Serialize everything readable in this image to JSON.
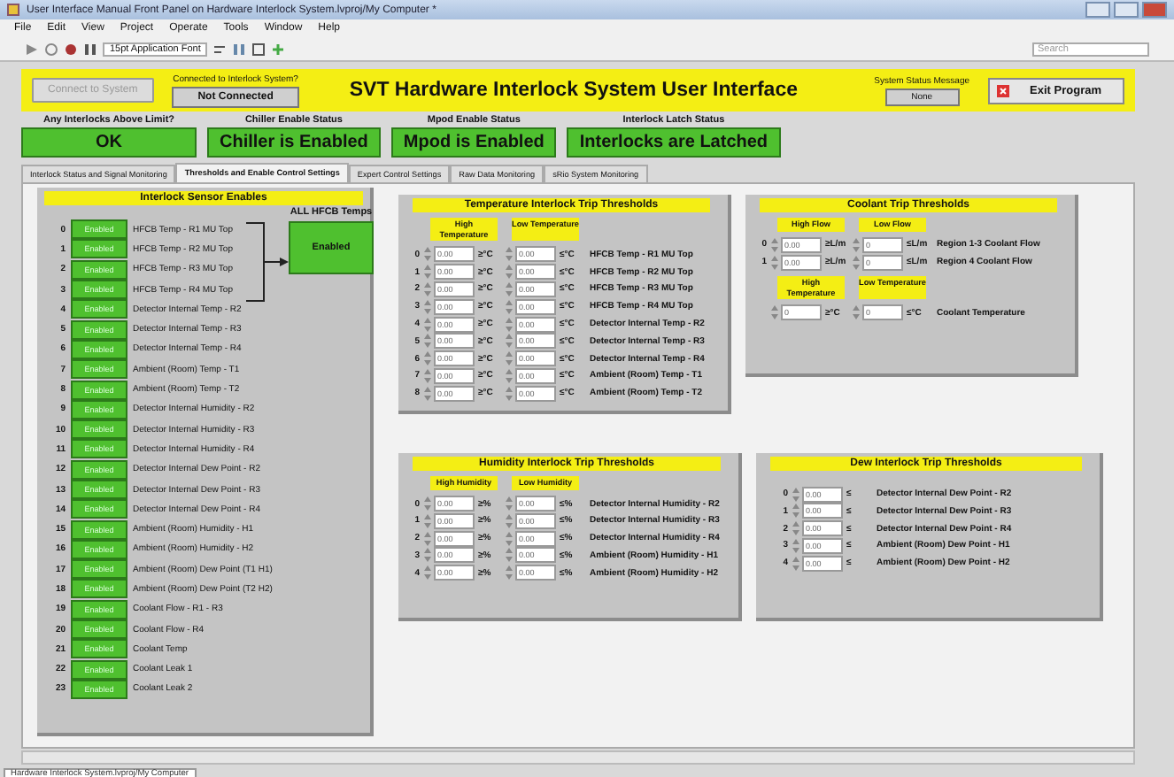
{
  "window": {
    "title": "User Interface Manual Front Panel on Hardware Interlock System.lvproj/My Computer *"
  },
  "menu": [
    "File",
    "Edit",
    "View",
    "Project",
    "Operate",
    "Tools",
    "Window",
    "Help"
  ],
  "toolbar": {
    "font": "15pt Application Font",
    "search_placeholder": "Search"
  },
  "header": {
    "connect_button": "Connect to System",
    "connected_label": "Connected to Interlock System?",
    "connected_value": "Not Connected",
    "title": "SVT Hardware Interlock System User Interface",
    "status_label": "System Status Message",
    "status_value": "None",
    "exit_button": "Exit Program"
  },
  "indicators": [
    {
      "label": "Any Interlocks Above Limit?",
      "value": "OK"
    },
    {
      "label": "Chiller Enable Status",
      "value": "Chiller is Enabled"
    },
    {
      "label": "Mpod Enable Status",
      "value": "Mpod is Enabled"
    },
    {
      "label": "Interlock Latch Status",
      "value": "Interlocks are Latched"
    }
  ],
  "tabs": [
    {
      "label": "Interlock Status and Signal Monitoring",
      "selected": false
    },
    {
      "label": "Thresholds and Enable Control Settings",
      "selected": true
    },
    {
      "label": "Expert Control Settings",
      "selected": false
    },
    {
      "label": "Raw Data Monitoring",
      "selected": false
    },
    {
      "label": "sRio System Monitoring",
      "selected": false
    }
  ],
  "sensor_enables": {
    "title": "Interlock Sensor Enables",
    "all_hfcb": {
      "label": "ALL HFCB Temps",
      "button": "Enabled"
    },
    "rows": [
      {
        "index": "0",
        "button": "Enabled",
        "label": "HFCB Temp - R1 MU Top"
      },
      {
        "index": "1",
        "button": "Enabled",
        "label": "HFCB Temp - R2 MU Top"
      },
      {
        "index": "2",
        "button": "Enabled",
        "label": "HFCB Temp - R3 MU Top"
      },
      {
        "index": "3",
        "button": "Enabled",
        "label": "HFCB Temp - R4 MU Top"
      },
      {
        "index": "4",
        "button": "Enabled",
        "label": "Detector Internal Temp - R2"
      },
      {
        "index": "5",
        "button": "Enabled",
        "label": "Detector Internal Temp - R3"
      },
      {
        "index": "6",
        "button": "Enabled",
        "label": "Detector Internal Temp - R4"
      },
      {
        "index": "7",
        "button": "Enabled",
        "label": "Ambient (Room) Temp - T1"
      },
      {
        "index": "8",
        "button": "Enabled",
        "label": "Ambient (Room) Temp - T2"
      },
      {
        "index": "9",
        "button": "Enabled",
        "label": "Detector Internal Humidity - R2"
      },
      {
        "index": "10",
        "button": "Enabled",
        "label": "Detector Internal Humidity - R3"
      },
      {
        "index": "11",
        "button": "Enabled",
        "label": "Detector Internal Humidity - R4"
      },
      {
        "index": "12",
        "button": "Enabled",
        "label": "Detector Internal Dew Point - R2"
      },
      {
        "index": "13",
        "button": "Enabled",
        "label": "Detector Internal Dew Point - R3"
      },
      {
        "index": "14",
        "button": "Enabled",
        "label": "Detector Internal Dew Point - R4"
      },
      {
        "index": "15",
        "button": "Enabled",
        "label": "Ambient (Room) Humidity - H1"
      },
      {
        "index": "16",
        "button": "Enabled",
        "label": "Ambient (Room) Humidity - H2"
      },
      {
        "index": "17",
        "button": "Enabled",
        "label": "Ambient (Room) Dew Point (T1 H1)"
      },
      {
        "index": "18",
        "button": "Enabled",
        "label": "Ambient (Room) Dew Point (T2 H2)"
      },
      {
        "index": "19",
        "button": "Enabled",
        "label": "Coolant Flow - R1 - R3"
      },
      {
        "index": "20",
        "button": "Enabled",
        "label": "Coolant Flow - R4"
      },
      {
        "index": "21",
        "button": "Enabled",
        "label": "Coolant Temp"
      },
      {
        "index": "22",
        "button": "Enabled",
        "label": "Coolant Leak 1"
      },
      {
        "index": "23",
        "button": "Enabled",
        "label": "Coolant Leak 2"
      }
    ]
  },
  "temperature_thresholds": {
    "title": "Temperature Interlock Trip Thresholds",
    "columns": [
      "High Temperature",
      "Low Temperature"
    ],
    "rows": [
      {
        "index": "0",
        "high": "0.00",
        "high_unit": "≥°C",
        "low": "0.00",
        "low_unit": "≤°C",
        "label": "HFCB Temp - R1 MU Top"
      },
      {
        "index": "1",
        "high": "0.00",
        "high_unit": "≥°C",
        "low": "0.00",
        "low_unit": "≤°C",
        "label": "HFCB Temp - R2 MU Top"
      },
      {
        "index": "2",
        "high": "0.00",
        "high_unit": "≥°C",
        "low": "0.00",
        "low_unit": "≤°C",
        "label": "HFCB Temp - R3 MU Top"
      },
      {
        "index": "3",
        "high": "0.00",
        "high_unit": "≥°C",
        "low": "0.00",
        "low_unit": "≤°C",
        "label": "HFCB Temp - R4 MU Top"
      },
      {
        "index": "4",
        "high": "0.00",
        "high_unit": "≥°C",
        "low": "0.00",
        "low_unit": "≤°C",
        "label": "Detector Internal Temp - R2"
      },
      {
        "index": "5",
        "high": "0.00",
        "high_unit": "≥°C",
        "low": "0.00",
        "low_unit": "≤°C",
        "label": "Detector Internal Temp - R3"
      },
      {
        "index": "6",
        "high": "0.00",
        "high_unit": "≥°C",
        "low": "0.00",
        "low_unit": "≤°C",
        "label": "Detector Internal Temp - R4"
      },
      {
        "index": "7",
        "high": "0.00",
        "high_unit": "≥°C",
        "low": "0.00",
        "low_unit": "≤°C",
        "label": "Ambient (Room) Temp - T1"
      },
      {
        "index": "8",
        "high": "0.00",
        "high_unit": "≥°C",
        "low": "0.00",
        "low_unit": "≤°C",
        "label": "Ambient (Room) Temp - T2"
      }
    ]
  },
  "coolant_thresholds": {
    "title": "Coolant Trip Thresholds",
    "columns": [
      "High Flow",
      "Low Flow"
    ],
    "rows": [
      {
        "index": "0",
        "high": "0.00",
        "high_unit": "≥L/m",
        "low": "0",
        "low_unit": "≤L/m",
        "label": "Region 1-3 Coolant Flow"
      },
      {
        "index": "1",
        "high": "0.00",
        "high_unit": "≥L/m",
        "low": "0",
        "low_unit": "≤L/m",
        "label": "Region 4 Coolant Flow"
      }
    ],
    "temp_columns": [
      "High Temperature",
      "Low Temperature"
    ],
    "temp_row": {
      "high": "0",
      "high_unit": "≥°C",
      "low": "0",
      "low_unit": "≤°C",
      "label": "Coolant Temperature"
    }
  },
  "humidity_thresholds": {
    "title": "Humidity Interlock Trip Thresholds",
    "columns": [
      "High Humidity",
      "Low Humidity"
    ],
    "rows": [
      {
        "index": "0",
        "high": "0.00",
        "high_unit": "≥%",
        "low": "0.00",
        "low_unit": "≤%",
        "label": "Detector Internal Humidity - R2"
      },
      {
        "index": "1",
        "high": "0.00",
        "high_unit": "≥%",
        "low": "0.00",
        "low_unit": "≤%",
        "label": "Detector Internal Humidity - R3"
      },
      {
        "index": "2",
        "high": "0.00",
        "high_unit": "≥%",
        "low": "0.00",
        "low_unit": "≤%",
        "label": "Detector Internal Humidity - R4"
      },
      {
        "index": "3",
        "high": "0.00",
        "high_unit": "≥%",
        "low": "0.00",
        "low_unit": "≤%",
        "label": "Ambient (Room) Humidity - H1"
      },
      {
        "index": "4",
        "high": "0.00",
        "high_unit": "≥%",
        "low": "0.00",
        "low_unit": "≤%",
        "label": "Ambient (Room) Humidity - H2"
      }
    ]
  },
  "dew_thresholds": {
    "title": "Dew Interlock Trip Thresholds",
    "rows": [
      {
        "index": "0",
        "value": "0.00",
        "unit": "≤",
        "label": "Detector Internal Dew Point - R2"
      },
      {
        "index": "1",
        "value": "0.00",
        "unit": "≤",
        "label": "Detector Internal Dew Point - R3"
      },
      {
        "index": "2",
        "value": "0.00",
        "unit": "≤",
        "label": "Detector Internal Dew Point - R4"
      },
      {
        "index": "3",
        "value": "0.00",
        "unit": "≤",
        "label": "Ambient (Room) Dew Point - H1"
      },
      {
        "index": "4",
        "value": "0.00",
        "unit": "≤",
        "label": "Ambient (Room) Dew Point - H2"
      }
    ]
  },
  "status_bar": {
    "path": "Hardware Interlock System.lvproj/My Computer"
  }
}
